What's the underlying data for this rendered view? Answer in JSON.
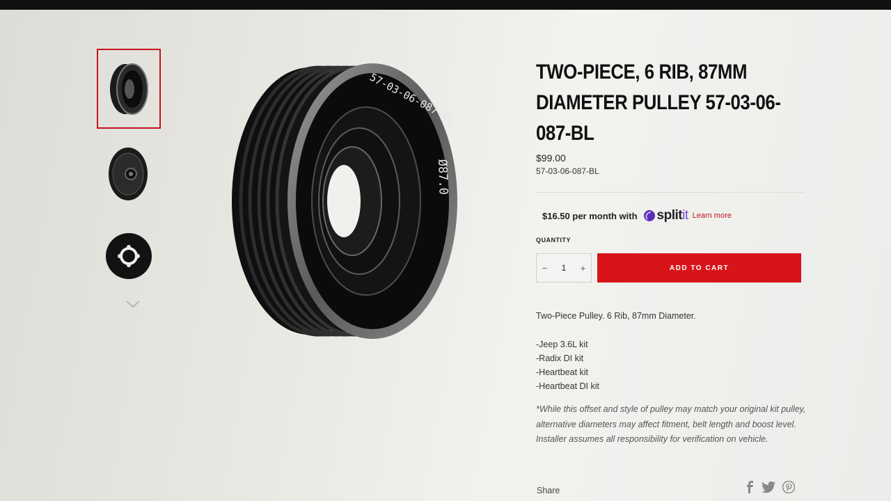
{
  "product": {
    "title": "TWO-PIECE, 6 RIB, 87MM DIAMETER PULLEY 57-03-06-087-BL",
    "price": "$99.00",
    "sku": "57-03-06-087-BL",
    "engraving_part": "57-03-06-087-BL",
    "engraving_diameter": "Ø87.0"
  },
  "financing": {
    "monthly": "$16.50 per month with",
    "brand_split": "split",
    "brand_it": "it",
    "learn_more": "Learn more"
  },
  "quantity": {
    "label": "QUANTITY",
    "minus": "−",
    "value": "1",
    "plus": "+"
  },
  "cart": {
    "add_label": "ADD TO CART"
  },
  "description": {
    "summary": "Two-Piece Pulley. 6 Rib, 87mm Diameter.",
    "kits": [
      "-Jeep 3.6L kit",
      "-Radix DI kit",
      "-Heartbeat kit",
      "-Heartbeat DI kit"
    ],
    "disclaimer": "*While this offset and style of pulley may match your original kit pulley, alternative diameters may affect fitment, belt length and boost level. Installer assumes all responsibility for verification on vehicle."
  },
  "share": {
    "label": "Share",
    "icons": [
      "facebook-icon",
      "twitter-icon",
      "pinterest-icon"
    ]
  },
  "colors": {
    "accent": "#d8141b",
    "splitit_purple": "#7a4bd8"
  }
}
